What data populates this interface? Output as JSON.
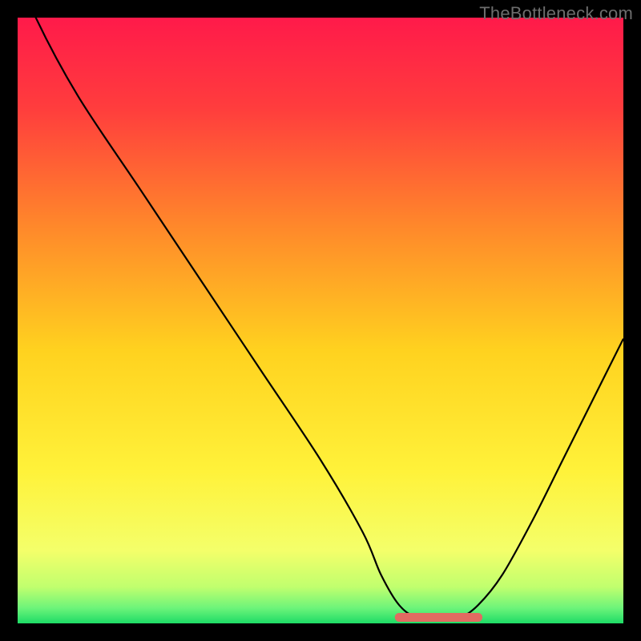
{
  "watermark": "TheBottleneck.com",
  "chart_data": {
    "type": "line",
    "title": "",
    "xlabel": "",
    "ylabel": "",
    "xlim": [
      0,
      100
    ],
    "ylim": [
      0,
      100
    ],
    "series": [
      {
        "name": "bottleneck-curve",
        "x": [
          0,
          3,
          10,
          20,
          30,
          40,
          50,
          57,
          60,
          63,
          66,
          70,
          73,
          76,
          80,
          85,
          90,
          95,
          100
        ],
        "y": [
          108,
          100,
          87,
          72,
          57,
          42,
          27,
          15,
          8,
          3,
          1,
          1,
          1,
          3,
          8,
          17,
          27,
          37,
          47
        ],
        "color": "#000000"
      },
      {
        "name": "optimal-band",
        "x": [
          63,
          66,
          70,
          73,
          76
        ],
        "y": [
          1,
          1,
          1,
          1,
          1
        ],
        "color": "#e26a61"
      }
    ],
    "background_gradient": {
      "stops": [
        {
          "pos": 0.0,
          "color": "#ff1a4a"
        },
        {
          "pos": 0.15,
          "color": "#ff3d3d"
        },
        {
          "pos": 0.35,
          "color": "#ff8a2a"
        },
        {
          "pos": 0.55,
          "color": "#ffd21f"
        },
        {
          "pos": 0.75,
          "color": "#fff23a"
        },
        {
          "pos": 0.88,
          "color": "#f4ff6a"
        },
        {
          "pos": 0.94,
          "color": "#c0ff6e"
        },
        {
          "pos": 0.975,
          "color": "#6cf47a"
        },
        {
          "pos": 1.0,
          "color": "#1edb66"
        }
      ]
    }
  }
}
